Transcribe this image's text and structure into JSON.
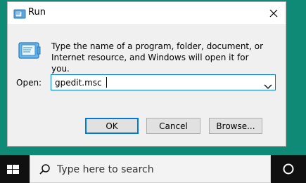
{
  "dialog": {
    "title": "Run",
    "description": "Type the name of a program, folder, document, or Internet resource, and Windows will open it for you.",
    "open_label": "Open:",
    "open_value": "gpedit.msc",
    "buttons": {
      "ok": "OK",
      "cancel": "Cancel",
      "browse": "Browse..."
    },
    "icons": {
      "title": "run-icon",
      "close": "close-icon",
      "body": "run-app-icon",
      "dropdown": "chevron-down-icon"
    }
  },
  "taskbar": {
    "search_placeholder": "Type here to search",
    "icons": {
      "start": "windows-logo-icon",
      "search": "search-icon",
      "cortana": "cortana-icon"
    }
  },
  "colors": {
    "desktop": "#0f8a77",
    "dialog_bg": "#f0f0f0",
    "accent": "#0078d7",
    "taskbar": "#101010"
  }
}
